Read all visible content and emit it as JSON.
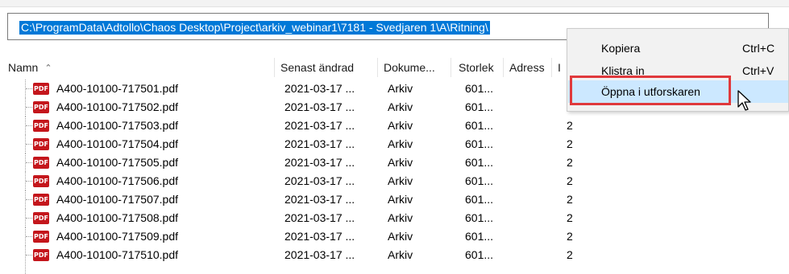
{
  "address_bar": {
    "path": "C:\\ProgramData\\Adtollo\\Chaos Desktop\\Project\\arkiv_webinar1\\7181 - Svedjaren 1\\A\\Ritning\\"
  },
  "columns": {
    "name": "Namn",
    "modified": "Senast ändrad",
    "doctype": "Dokume...",
    "size": "Storlek",
    "address": "Adress",
    "extra": "I"
  },
  "files": [
    {
      "name": "A400-10100-717501.pdf",
      "modified": "2021-03-17 ...",
      "type": "Arkiv",
      "size": "601...",
      "extra": ""
    },
    {
      "name": "A400-10100-717502.pdf",
      "modified": "2021-03-17 ...",
      "type": "Arkiv",
      "size": "601...",
      "extra": ""
    },
    {
      "name": "A400-10100-717503.pdf",
      "modified": "2021-03-17 ...",
      "type": "Arkiv",
      "size": "601...",
      "extra": "2"
    },
    {
      "name": "A400-10100-717504.pdf",
      "modified": "2021-03-17 ...",
      "type": "Arkiv",
      "size": "601...",
      "extra": "2"
    },
    {
      "name": "A400-10100-717505.pdf",
      "modified": "2021-03-17 ...",
      "type": "Arkiv",
      "size": "601...",
      "extra": "2"
    },
    {
      "name": "A400-10100-717506.pdf",
      "modified": "2021-03-17 ...",
      "type": "Arkiv",
      "size": "601...",
      "extra": "2"
    },
    {
      "name": "A400-10100-717507.pdf",
      "modified": "2021-03-17 ...",
      "type": "Arkiv",
      "size": "601...",
      "extra": "2"
    },
    {
      "name": "A400-10100-717508.pdf",
      "modified": "2021-03-17 ...",
      "type": "Arkiv",
      "size": "601...",
      "extra": "2"
    },
    {
      "name": "A400-10100-717509.pdf",
      "modified": "2021-03-17 ...",
      "type": "Arkiv",
      "size": "601...",
      "extra": "2"
    },
    {
      "name": "A400-10100-717510.pdf",
      "modified": "2021-03-17 ...",
      "type": "Arkiv",
      "size": "601...",
      "extra": "2"
    }
  ],
  "context_menu": {
    "copy_label": "Kopiera",
    "copy_shortcut": "Ctrl+C",
    "paste_label": "Klistra in",
    "paste_shortcut": "Ctrl+V",
    "open_label": "Öppna i utforskaren"
  },
  "icons": {
    "file_icon": "pdf-file-icon",
    "pdf_icon_text": "PDF"
  },
  "colors": {
    "selection": "#0078d7",
    "menu_highlight": "#cce8ff",
    "callout": "#e0393c",
    "pdf_icon": "#c4161c"
  }
}
